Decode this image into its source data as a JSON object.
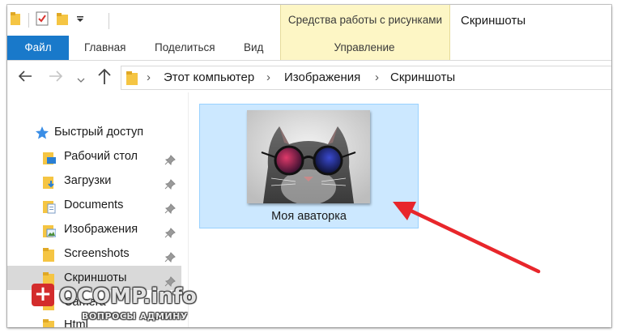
{
  "window": {
    "title": "Скриншоты",
    "contextual_group": "Средства работы с рисунками"
  },
  "ribbon": {
    "tabs": [
      {
        "label": "Файл"
      },
      {
        "label": "Главная"
      },
      {
        "label": "Поделиться"
      },
      {
        "label": "Вид"
      },
      {
        "label": "Управление"
      }
    ]
  },
  "address": {
    "crumbs": [
      "Этот компьютер",
      "Изображения",
      "Скриншоты"
    ]
  },
  "navpane": {
    "items": [
      {
        "label": "Быстрый доступ",
        "icon": "star-icon"
      },
      {
        "label": "Рабочий стол",
        "icon": "desktop-folder-icon"
      },
      {
        "label": "Загрузки",
        "icon": "downloads-folder-icon"
      },
      {
        "label": "Documents",
        "icon": "documents-folder-icon"
      },
      {
        "label": "Изображения",
        "icon": "pictures-folder-icon"
      },
      {
        "label": "Screenshots",
        "icon": "folder-icon"
      },
      {
        "label": "Скриншоты",
        "icon": "folder-icon",
        "selected": true
      },
      {
        "label": "Camera",
        "icon": "folder-icon"
      },
      {
        "label": "Html",
        "icon": "folder-icon"
      }
    ]
  },
  "content": {
    "files": [
      {
        "name": "Моя аваторка",
        "icon": "cat-glasses-thumbnail"
      }
    ]
  },
  "watermark": {
    "brand": "OCOMP.info",
    "tagline": "ВОПРОСЫ АДМИНУ"
  },
  "colors": {
    "accent": "#1979ca",
    "contextual": "#fdf6c5",
    "selection": "#cce8ff",
    "arrow": "#e8262b"
  }
}
